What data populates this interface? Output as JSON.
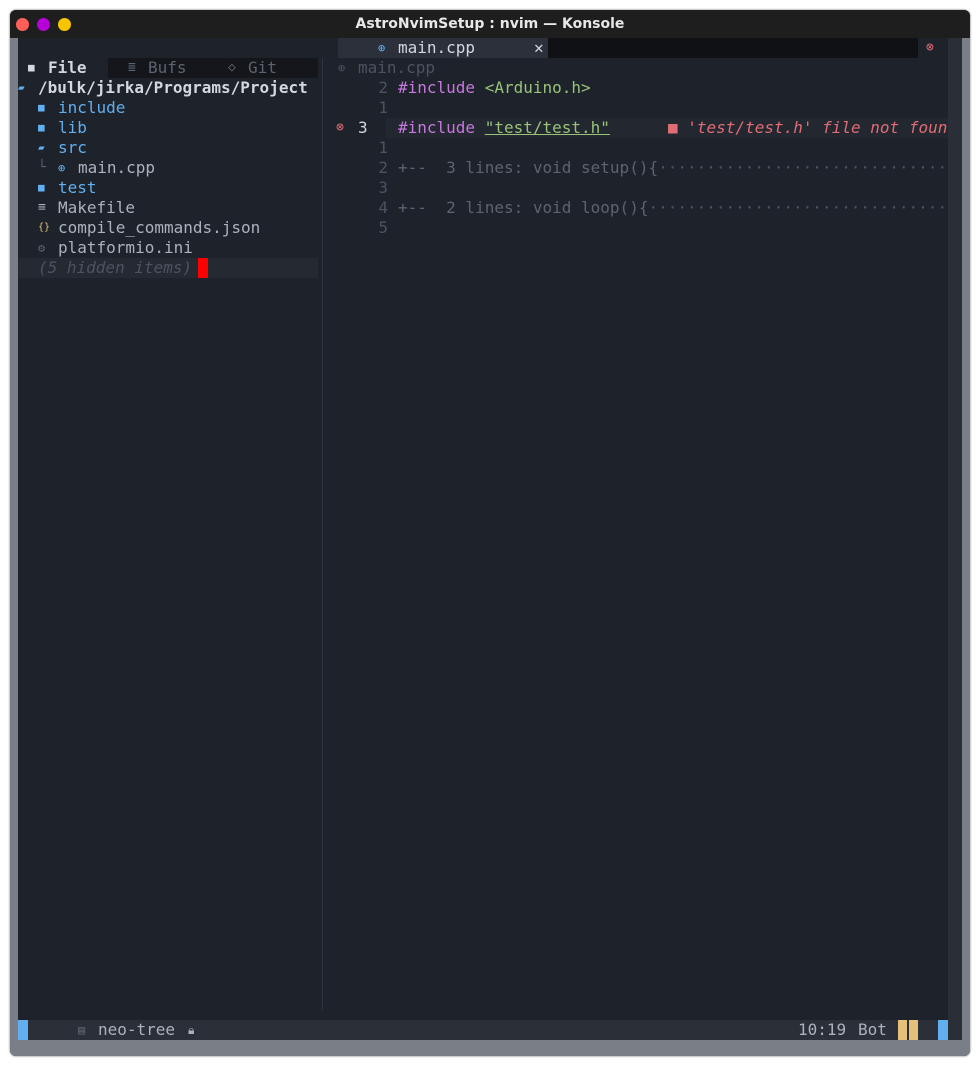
{
  "window": {
    "title": "AstroNvimSetup : nvim — Konsole"
  },
  "tabline": {
    "active_tab": "main.cpp",
    "close_icon_char": "✕",
    "close_all_icon_char": "⊗"
  },
  "sidebar": {
    "source_tabs": [
      {
        "label": "File",
        "icon": "folder-icon",
        "glyph": "■",
        "active": true
      },
      {
        "label": "Bufs",
        "icon": "buffers-icon",
        "glyph": "≣",
        "active": false
      },
      {
        "label": "Git",
        "icon": "git-icon",
        "glyph": "◇",
        "active": false
      }
    ],
    "root_path": "/bulk/jirka/Programs/Project",
    "tree": [
      {
        "label": "include",
        "type": "folder",
        "glyph": "■"
      },
      {
        "label": "lib",
        "type": "folder",
        "glyph": "■"
      },
      {
        "label": "src",
        "type": "folder-open",
        "glyph": "▰"
      },
      {
        "label": "main.cpp",
        "type": "cpp-file",
        "glyph": "⊕",
        "indent_glyph": "└"
      },
      {
        "label": "test",
        "type": "folder",
        "glyph": "■"
      },
      {
        "label": "Makefile",
        "type": "text-file",
        "glyph": "≡"
      },
      {
        "label": "compile_commands.json",
        "type": "json-file",
        "glyph": "{}"
      },
      {
        "label": "platformio.ini",
        "type": "config-file",
        "glyph": "⚙"
      }
    ],
    "hidden_items": "(5 hidden items)"
  },
  "editor": {
    "winbar": "main.cpp",
    "lines": [
      {
        "num": "2",
        "diag": "",
        "parts": [
          {
            "t": "#include ",
            "c": "purple"
          },
          {
            "t": "<Arduino.h>",
            "c": "green"
          }
        ]
      },
      {
        "num": "1",
        "diag": "",
        "parts": []
      },
      {
        "num": "3",
        "diag": "⊗",
        "current": true,
        "parts": [
          {
            "t": "#include ",
            "c": "purple"
          },
          {
            "t": "\"test/test.h\"",
            "c": "green-underline"
          }
        ],
        "virtual_text": "■ 'test/test.h' file not foun"
      },
      {
        "num": "1",
        "diag": "",
        "parts": []
      },
      {
        "num": "2",
        "diag": "",
        "parts": [
          {
            "t": "+--  3 lines: void setup(){",
            "c": "dim"
          },
          {
            "t": "··································",
            "c": "dark"
          }
        ]
      },
      {
        "num": "3",
        "diag": "",
        "parts": []
      },
      {
        "num": "4",
        "diag": "",
        "parts": [
          {
            "t": "+--  2 lines: void loop(){",
            "c": "dim"
          },
          {
            "t": "···································",
            "c": "dark"
          }
        ]
      },
      {
        "num": "5",
        "diag": "",
        "parts": []
      }
    ]
  },
  "statusline": {
    "file_icon": "file-icon",
    "filetype": "neo-tree",
    "lock_icon": "lock-icon",
    "position": "10:19",
    "scroll": "Bot"
  }
}
